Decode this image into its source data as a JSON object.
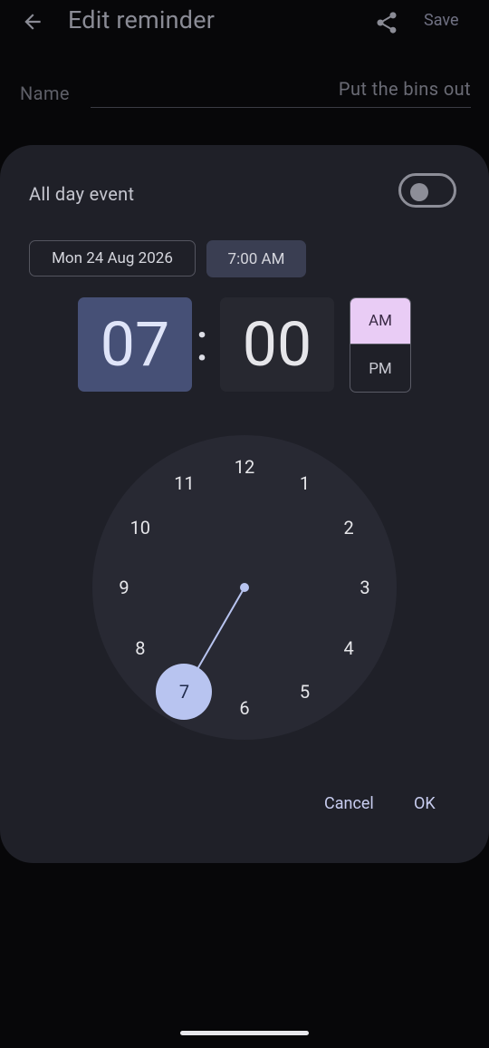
{
  "header": {
    "title": "Edit reminder",
    "save_label": "Save",
    "back_icon": "arrow-left-icon",
    "share_icon": "share-icon"
  },
  "name": {
    "label": "Name",
    "value": "Put the bins out"
  },
  "dialog": {
    "all_day_label": "All day event",
    "all_day_enabled": false,
    "date_chip": "Mon 24 Aug 2026",
    "time_chip": "7:00 AM",
    "hour": "07",
    "separator": ":",
    "minute": "00",
    "am_label": "AM",
    "pm_label": "PM",
    "selected_period": "AM",
    "clock_numbers": [
      "12",
      "1",
      "2",
      "3",
      "4",
      "5",
      "6",
      "7",
      "8",
      "9",
      "10",
      "11"
    ],
    "selected_hour": "7",
    "cancel_label": "Cancel",
    "ok_label": "OK"
  },
  "colors": {
    "background": "#070709",
    "dialog": "#1f2028",
    "hour_selected": "#465076",
    "am_selected": "#e9ccf5",
    "clock_hand": "#b8c4f0"
  }
}
